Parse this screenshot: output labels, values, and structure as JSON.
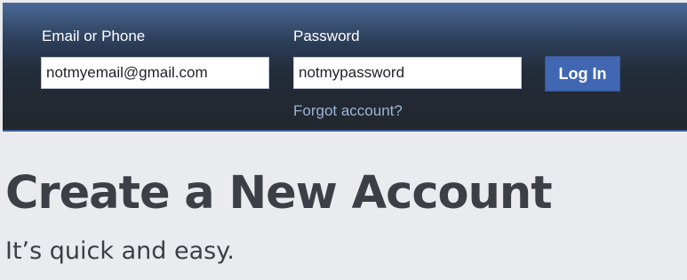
{
  "login": {
    "email_label": "Email or Phone",
    "email_value": "notmyemail@gmail.com",
    "password_label": "Password",
    "password_value": "notmypassword",
    "login_button_label": "Log In",
    "forgot_link": "Forgot account?"
  },
  "signup": {
    "heading": "Create a New Account",
    "subheading": "It’s quick and easy."
  },
  "colors": {
    "header_dark": "#23272d",
    "header_top": "#4a6a9b",
    "button_blue": "#4267b2",
    "link_blue": "#9cb4d8",
    "page_background": "#e9ebee",
    "heading_text": "#3c3f45"
  }
}
